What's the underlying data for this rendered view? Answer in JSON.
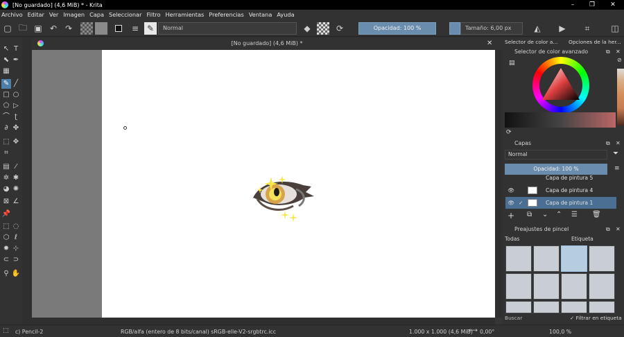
{
  "window": {
    "title": "[No guardado]  (4,6 MiB) * - Krita",
    "minimize": "–",
    "maximize": "❐",
    "close": "✕"
  },
  "menu": [
    "Archivo",
    "Editar",
    "Ver",
    "Imagen",
    "Capa",
    "Seleccionar",
    "Filtro",
    "Herramientas",
    "Preferencias",
    "Ventana",
    "Ayuda"
  ],
  "toolbar": {
    "blend_mode": "Normal",
    "opacity": "Opacidad: 100 %",
    "size": "Tamaño: 6,00 px"
  },
  "document": {
    "tab_title": "[No guardado]  (4,6 MiB) *",
    "close": "✕"
  },
  "right_tabs": [
    "Selector de color a...",
    "Opciones de la her..."
  ],
  "color_panel": {
    "title": "Selector de color avanzado"
  },
  "layers": {
    "title": "Capas",
    "blend_mode": "Normal",
    "opacity": "Opacidad: 100 %",
    "items": [
      "Capa de pintura 5",
      "Capa de pintura 4",
      "Capa de pintura 1"
    ]
  },
  "brushes": {
    "title": "Preajustes de pincel",
    "filter": "Todas",
    "tag": "Etiqueta",
    "search_placeholder": "Buscar",
    "filter_tag_label": "Filtrar en etiqueta"
  },
  "status": {
    "brush": "c) Pencil-2",
    "colorspace": "RGB/alfa (entero de 8 bits/canal)  sRGB-elle-V2-srgbtrc.icc",
    "dimensions": "1.000 x 1.000 (4,6 MiB)",
    "rotation": "0,00°",
    "zoom": "100,0 %"
  }
}
